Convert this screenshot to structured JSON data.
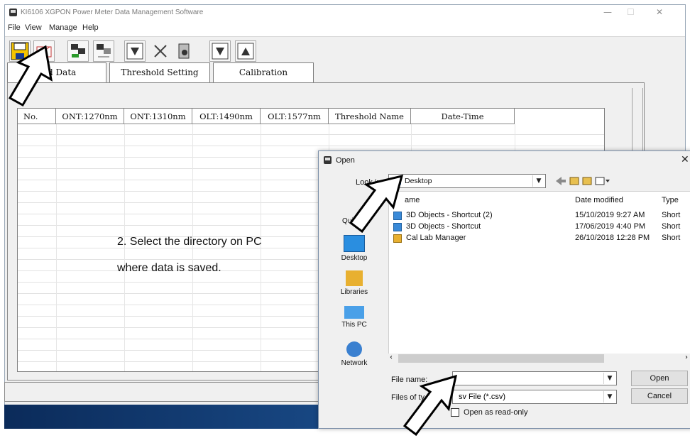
{
  "app": {
    "title": "KI6106 XGPON Power Meter Data Management Software",
    "window_controls": [
      "—",
      "☐",
      "✕"
    ]
  },
  "menu": {
    "file": "File",
    "view": "View",
    "manage": "Manage",
    "help": "Help"
  },
  "toolbar": {
    "icons": [
      "save-icon",
      "open-icon",
      "connect-icon",
      "disconnect-icon",
      "download-icon",
      "delete-icon",
      "settings-icon",
      "import-icon",
      "upload-icon"
    ]
  },
  "tabs": {
    "download": "oad Data",
    "threshold": "Threshold Setting",
    "calibration": "Calibration"
  },
  "table": {
    "columns": [
      "No.",
      "ONT:1270nm",
      "ONT:1310nm",
      "OLT:1490nm",
      "OLT:1577nm",
      "Threshold Name",
      "Date-Time"
    ]
  },
  "instruction": {
    "line1": "2. Select the directory on PC",
    "line2": "where data is saved."
  },
  "dialog": {
    "title": "Open",
    "close": "✕",
    "look_in_label": "Look in:",
    "look_in_value": "Desktop",
    "places": {
      "quick_access": "Quick a",
      "desktop": "Desktop",
      "libraries": "Libraries",
      "this_pc": "This PC",
      "network": "Network"
    },
    "columns": {
      "name": "ame",
      "date": "Date modified",
      "type": "Type"
    },
    "files": [
      {
        "name": "3D Objects - Shortcut (2)",
        "date": "15/10/2019 9:27 AM",
        "type": "Short"
      },
      {
        "name": "3D Objects - Shortcut",
        "date": "17/06/2019 4:40 PM",
        "type": "Short"
      },
      {
        "name": "Cal Lab Manager",
        "date": "26/10/2018 12:28 PM",
        "type": "Short"
      }
    ],
    "file_name_label": "File name:",
    "file_name_value": "",
    "files_of_type_label": "Files of ty",
    "files_of_type_value": "sv File (*.csv)",
    "open_button": "Open",
    "cancel_button": "Cancel",
    "readonly_label": "Open as read-only"
  },
  "colors": {
    "taskbar": "#1a4c8a",
    "save_icon": "#f5c400",
    "dialog_border": "#7a8ea8"
  }
}
